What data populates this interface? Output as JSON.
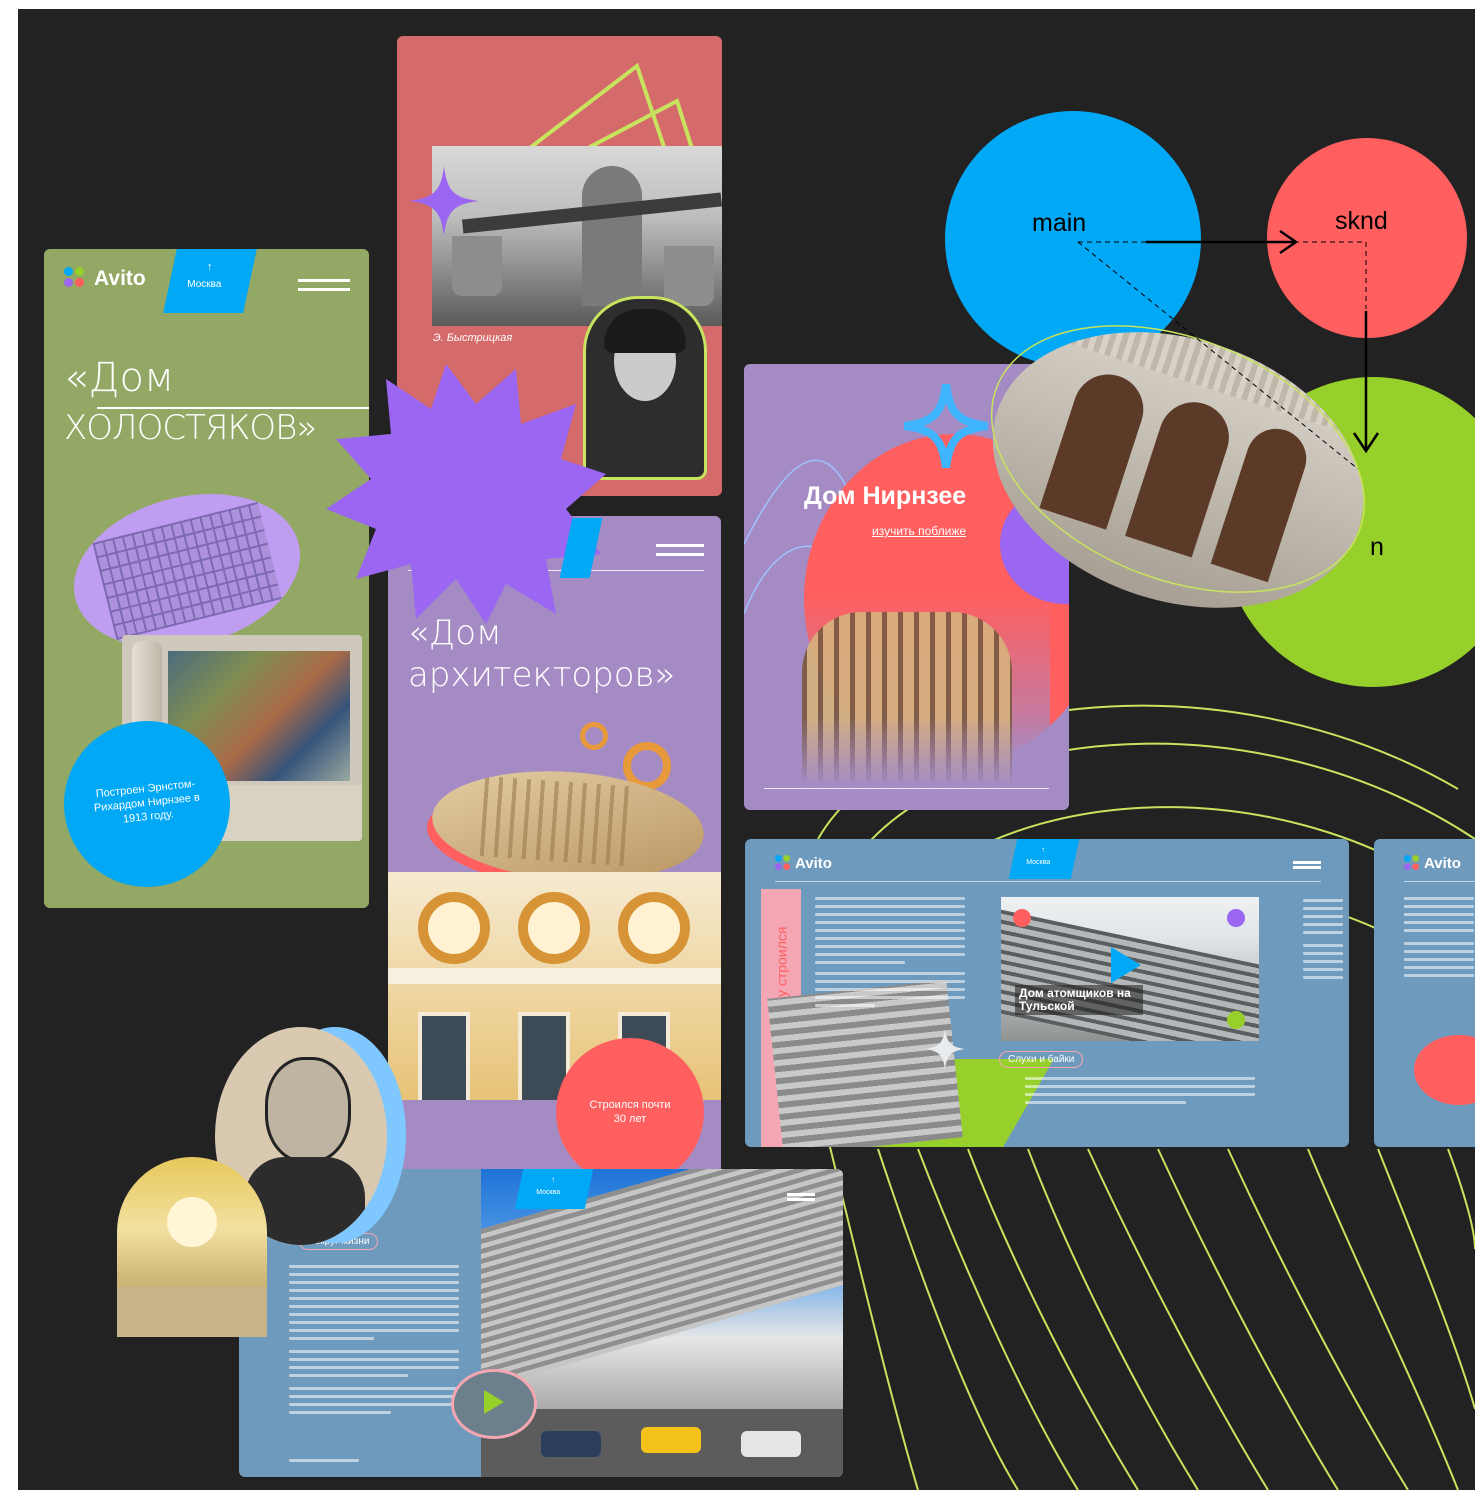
{
  "colors": {
    "background": "#222222",
    "avito_green_card": "#93a865",
    "salmon_card": "#d46a6a",
    "lavender_card": "#a48bc4",
    "blue_card": "#6d9abd",
    "accent_blue": "#00a8f5",
    "accent_red": "#ff5f5f",
    "accent_green": "#97d02a",
    "accent_purple": "#9b66f2",
    "line_lime": "#c8e35e"
  },
  "brand": {
    "name": "Avito"
  },
  "city_tag": {
    "arrow": "↑",
    "label": "Москва"
  },
  "cards": {
    "dom_holostyakov": {
      "title_line1": "«Дом",
      "title_line2": "холостяков»",
      "bubble": "Построен Эрнстом-Рихардом Нирнзее в 1913 году."
    },
    "portrait_card": {
      "caption": "Э. Быстрицкая"
    },
    "dom_arhitektorov": {
      "title_line1": "«Дом",
      "title_line2": "архитекторов»",
      "bubble": "Строился почти 30 лет"
    },
    "dom_nirnzee": {
      "title": "Дом Нирнзее",
      "link": "изучить поближе"
    },
    "desktop_atomshchikov": {
      "vertical_label": "Не сразу строился",
      "photo_caption": "Дом атомщиков на Тульской",
      "pill": "Слухи и байки"
    },
    "desktop_bottom": {
      "pill": "Вокруг жизни"
    }
  },
  "diagram": {
    "nodes": [
      "main",
      "sknd",
      "n"
    ]
  },
  "icons": {
    "arrow_up": "↑",
    "star": "four-point-star",
    "play": "play-triangle"
  }
}
